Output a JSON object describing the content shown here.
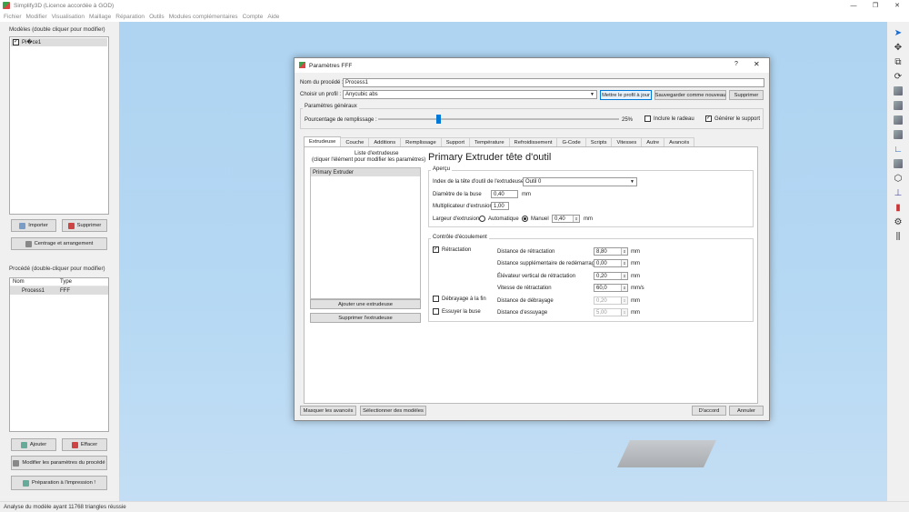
{
  "app": {
    "title": "Simplify3D (Licence accordée à GOD)",
    "window_controls": {
      "minimize": "—",
      "maximize": "❐",
      "close": "✕"
    }
  },
  "menu": [
    "Fichier",
    "Modifier",
    "Visualisation",
    "Maillage",
    "Réparation",
    "Outils",
    "Modules complémentaires",
    "Compte",
    "Aide"
  ],
  "left_panel": {
    "models_label": "Modèles (double cliquer pour modifier)",
    "models": [
      {
        "name": "Pi�ce1",
        "checked": true
      }
    ],
    "import_button": "Importer",
    "delete_button": "Supprimer",
    "center_button": "Centrage et arrangement",
    "processes_label": "Procédé (double-cliquer pour modifier)",
    "process_columns": [
      "Nom",
      "Type"
    ],
    "processes": [
      {
        "name": "Process1",
        "type": "FFF"
      }
    ],
    "add_button": "Ajouter",
    "erase_button": "Effacer",
    "edit_process_button": "Modifier les paramètres du procédé",
    "prepare_button": "Préparation à l'impression !"
  },
  "status": "Analyse du modèle ayant 11768 triangles réussie",
  "dialog": {
    "title": "Paramètres FFF",
    "help": "?",
    "close": "✕",
    "process_name_label": "Nom du procédé :",
    "process_name_value": "Process1",
    "profile_label": "Choisir un profil :",
    "profile_value": "Anycubic abs",
    "update_profile_button": "Mettre le profil à jour",
    "save_new_button": "Sauvegarder comme nouveau",
    "delete_button": "Supprimer",
    "general_group": "Paramètres généraux",
    "infill_label": "Pourcentage de remplissage :",
    "infill_value_label": "25%",
    "infill_percent": 25,
    "raft_label": "Inclure le radeau",
    "raft_checked": false,
    "support_label": "Générer le support",
    "support_checked": true,
    "tabs": [
      "Extrudeuse",
      "Couche",
      "Additions",
      "Remplissage",
      "Support",
      "Température",
      "Refroidissement",
      "G-Code",
      "Scripts",
      "Vitesses",
      "Autre",
      "Avancés"
    ],
    "active_tab": "Extrudeuse",
    "extruder_list_title": "Liste d'extrudeuse",
    "extruder_list_hint": "(cliquer l'élément pour modifier les paramètres)",
    "extruders": [
      "Primary Extruder"
    ],
    "add_extruder_button": "Ajouter une extrudeuse",
    "remove_extruder_button": "Supprimer l'extrudeuse",
    "extruder_heading": "Primary Extruder tête d'outil",
    "overview_group": "Aperçu",
    "tool_index_label": "Index de la tête d'outil de l'extrudeuse",
    "tool_index_value": "Outil 0",
    "nozzle_label": "Diamètre de la buse",
    "nozzle_value": "0,40",
    "nozzle_unit": "mm",
    "multiplier_label": "Multiplicateur d'extrusion",
    "multiplier_value": "1,00",
    "width_label": "Largeur d'extrusion",
    "width_auto_label": "Automatique",
    "width_manual_label": "Manuel",
    "width_value": "0,40",
    "width_unit": "mm",
    "ooze_group": "Contrôle d'écoulement",
    "retraction_label": "Rétractation",
    "retraction_checked": true,
    "retract_distance_label": "Distance de rétractation",
    "retract_distance_value": "8,80",
    "retract_distance_unit": "mm",
    "extra_restart_label": "Distance supplémentaire de redémarrage",
    "extra_restart_value": "0,00",
    "extra_restart_unit": "mm",
    "lift_label": "Élévateur vertical de rétractation",
    "lift_value": "0,20",
    "lift_unit": "mm",
    "retract_speed_label": "Vitesse de rétractation",
    "retract_speed_value": "60,0",
    "retract_speed_unit": "mm/s",
    "coast_label": "Débrayage à la fin",
    "coast_checked": false,
    "coast_distance_label": "Distance de débrayage",
    "coast_distance_value": "0,20",
    "coast_distance_unit": "mm",
    "wipe_label": "Essuyer la buse",
    "wipe_checked": false,
    "wipe_distance_label": "Distance d'essuyage",
    "wipe_distance_value": "5,00",
    "wipe_distance_unit": "mm",
    "hide_advanced_button": "Masquer les avancés",
    "select_models_button": "Sélectionner des modèles",
    "ok_button": "D'accord",
    "cancel_button": "Annuler"
  },
  "colors": {
    "viewport": "#b5d8f3",
    "accent": "#0078d7"
  }
}
